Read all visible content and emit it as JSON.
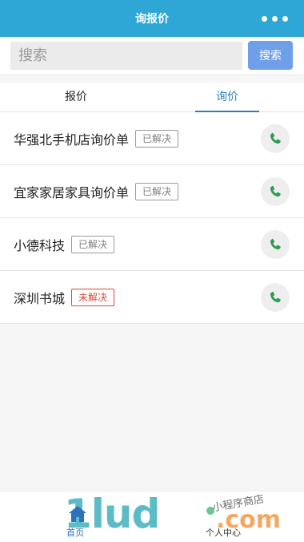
{
  "header": {
    "title": "询报价",
    "more_icon": "more-dots-icon"
  },
  "search": {
    "placeholder": "搜索",
    "value": "",
    "button_label": "搜索"
  },
  "tabs": [
    {
      "label": "报价",
      "active": false
    },
    {
      "label": "询价",
      "active": true
    }
  ],
  "list": {
    "items": [
      {
        "name": "华强北手机店询价单",
        "status": "已解决",
        "status_type": "resolved",
        "icon": "phone-icon"
      },
      {
        "name": "宜家家居家具询价单",
        "status": "已解决",
        "status_type": "resolved",
        "icon": "phone-icon"
      },
      {
        "name": "小德科技",
        "status": "已解决",
        "status_type": "resolved",
        "icon": "phone-icon"
      },
      {
        "name": "深圳书城",
        "status": "未解决",
        "status_type": "unresolved",
        "icon": "phone-icon"
      }
    ]
  },
  "footer": {
    "home_label": "首页",
    "profile_label": "个人中心",
    "home_icon": "home-icon"
  },
  "watermark": {
    "brand": "1lud",
    "com": ".com",
    "script": "小程序商店"
  },
  "colors": {
    "header_bg": "#2ea6d6",
    "search_button": "#6f9fe9",
    "active_tab": "#2d7fba",
    "resolved_border": "#9a9a9a",
    "unresolved_border": "#d84a3a",
    "phone_green": "#2f9b4d"
  }
}
